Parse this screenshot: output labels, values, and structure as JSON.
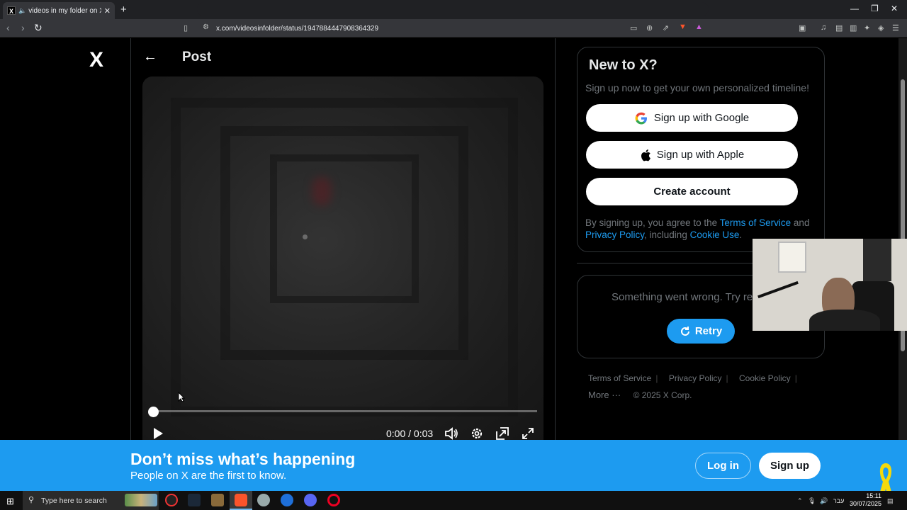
{
  "browser": {
    "tab_title": "videos in my folder on X: \"htt",
    "tab_favicon": "X",
    "url": "x.com/videosinfolder/status/1947884447908364329",
    "new_tab": "+",
    "win_min": "—",
    "win_max": "❐",
    "win_close": "✕"
  },
  "header": {
    "logo": "X",
    "back": "←",
    "title": "Post"
  },
  "video": {
    "time": "0:00 / 0:03",
    "progress": 0
  },
  "signup": {
    "title": "New to X?",
    "subtitle": "Sign up now to get your own personalized timeline!",
    "google_label": "Sign up with Google",
    "apple_label": "Sign up with Apple",
    "create_label": "Create account",
    "legal_prefix": "By signing up, you agree to the ",
    "terms": "Terms of Service",
    "and": " and ",
    "privacy": "Privacy Policy",
    "including": ", including ",
    "cookie": "Cookie Use",
    "period": "."
  },
  "trends": {
    "error_text": "Something went wrong. Try reloading.",
    "retry_label": "Retry"
  },
  "footer": {
    "links": [
      "Terms of Service",
      "Privacy Policy",
      "Cookie Policy"
    ],
    "more": "More ···",
    "copyright": "© 2025 X Corp."
  },
  "banner": {
    "title": "Don’t miss what’s happening",
    "subtitle": "People on X are the first to know.",
    "login_label": "Log in",
    "signup_label": "Sign up"
  },
  "taskbar": {
    "search_placeholder": "Type here to search",
    "language": "עבר",
    "time": "15:11",
    "date": "30/07/2025"
  },
  "colors": {
    "accent": "#1d9bf0",
    "background": "#000000"
  }
}
